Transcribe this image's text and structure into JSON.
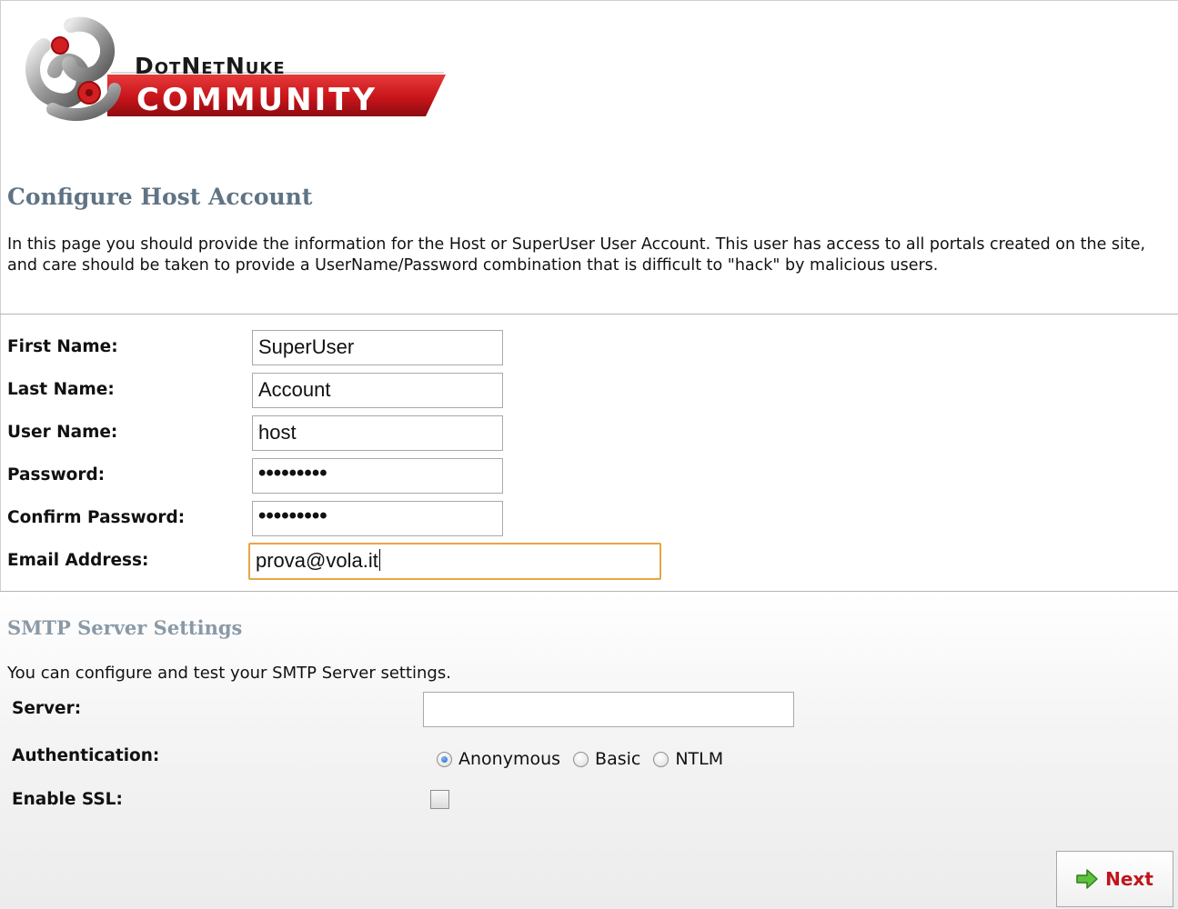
{
  "logo": {
    "brand_top": "DotNetNuke",
    "brand_bottom": "COMMUNITY",
    "accent_color": "#c8151b"
  },
  "host_account": {
    "title": "Configure Host Account",
    "intro": "In this page you should provide the information for the Host or SuperUser User Account. This user has access to all portals created on the site, and care should be taken to provide a UserName/Password combination that is difficult to \"hack\" by malicious users.",
    "fields": {
      "first_name": {
        "label": "First Name:",
        "value": "SuperUser"
      },
      "last_name": {
        "label": "Last Name:",
        "value": "Account"
      },
      "user_name": {
        "label": "User Name:",
        "value": "host"
      },
      "password": {
        "label": "Password:",
        "value": "•••••••••"
      },
      "confirm_password": {
        "label": "Confirm Password:",
        "value": "•••••••••"
      },
      "email": {
        "label": "Email Address:",
        "value": "prova@vola.it"
      }
    }
  },
  "smtp": {
    "title": "SMTP Server Settings",
    "description": "You can configure and test your SMTP Server settings.",
    "server_label": "Server:",
    "server_value": "",
    "auth_label": "Authentication:",
    "auth_options": [
      "Anonymous",
      "Basic",
      "NTLM"
    ],
    "auth_selected": "Anonymous",
    "ssl_label": "Enable SSL:",
    "ssl_checked": false
  },
  "actions": {
    "next_label": "Next",
    "next_icon": "arrow-right-icon"
  }
}
